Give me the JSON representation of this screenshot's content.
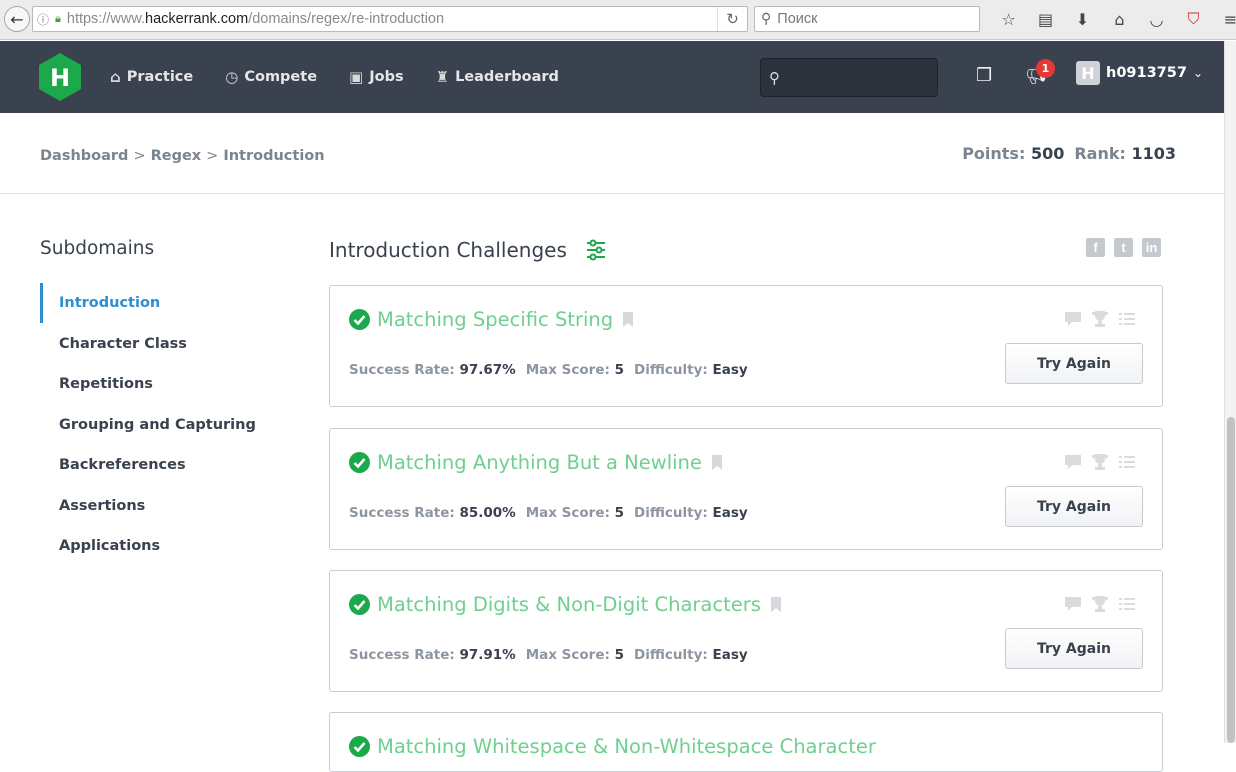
{
  "browser": {
    "url_prefix": "https://www.",
    "url_host": "hackerrank.com",
    "url_path": "/domains/regex/re-introduction",
    "search_placeholder": "Поиск",
    "icons": [
      "star-icon",
      "reader-icon",
      "download-icon",
      "home-icon",
      "pocket-icon",
      "adblock-icon",
      "menu-icon"
    ]
  },
  "header": {
    "logo_letter": "H",
    "nav": [
      {
        "label": "Practice",
        "icon": "home-icon"
      },
      {
        "label": "Compete",
        "icon": "clock-icon"
      },
      {
        "label": "Jobs",
        "icon": "briefcase-icon"
      },
      {
        "label": "Leaderboard",
        "icon": "trophy-icon"
      }
    ],
    "notification_count": "1",
    "username": "h0913757",
    "avatar_letter": "H"
  },
  "breadcrumb": {
    "items": [
      "Dashboard",
      "Regex",
      "Introduction"
    ],
    "separator": ">"
  },
  "stats": {
    "points_label": "Points:",
    "points_value": "500",
    "rank_label": "Rank:",
    "rank_value": "1103"
  },
  "sidebar": {
    "title": "Subdomains",
    "items": [
      {
        "label": "Introduction",
        "active": true
      },
      {
        "label": "Character Class"
      },
      {
        "label": "Repetitions"
      },
      {
        "label": "Grouping and Capturing"
      },
      {
        "label": "Backreferences"
      },
      {
        "label": "Assertions"
      },
      {
        "label": "Applications"
      }
    ]
  },
  "main": {
    "title": "Introduction Challenges",
    "share": [
      "f",
      "t",
      "in"
    ],
    "challenges": [
      {
        "title": "Matching Specific String",
        "success_label": "Success Rate:",
        "success_rate": "97.67%",
        "max_label": "Max Score:",
        "max_score": "5",
        "difficulty_label": "Difficulty:",
        "difficulty": "Easy",
        "button": "Try Again"
      },
      {
        "title": "Matching Anything But a Newline",
        "success_label": "Success Rate:",
        "success_rate": "85.00%",
        "max_label": "Max Score:",
        "max_score": "5",
        "difficulty_label": "Difficulty:",
        "difficulty": "Easy",
        "button": "Try Again"
      },
      {
        "title": "Matching Digits & Non-Digit Characters",
        "success_label": "Success Rate:",
        "success_rate": "97.91%",
        "max_label": "Max Score:",
        "max_score": "5",
        "difficulty_label": "Difficulty:",
        "difficulty": "Easy",
        "button": "Try Again"
      },
      {
        "title": "Matching Whitespace & Non-Whitespace Character"
      }
    ]
  },
  "colors": {
    "header_bg": "#39424e",
    "accent_green": "#1ba94c",
    "title_green": "#6fcf8f",
    "active_blue": "#2f8ecf",
    "badge_red": "#e53935"
  }
}
